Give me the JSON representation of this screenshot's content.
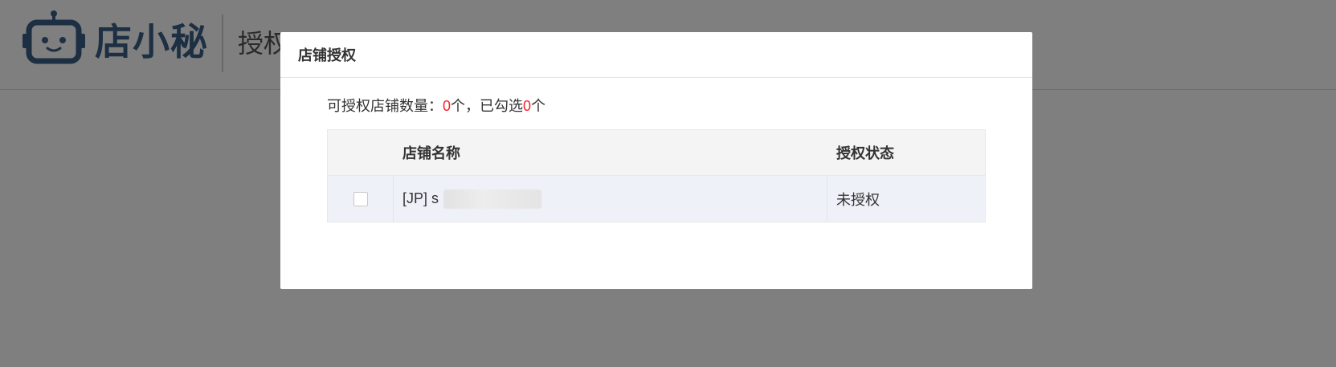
{
  "header": {
    "brand": "店小秘",
    "subtitle": "授权"
  },
  "modal": {
    "title": "店铺授权",
    "summary": {
      "prefix": "可授权店铺数量：",
      "available_count": "0",
      "middle": "个，已勾选",
      "selected_count": "0",
      "suffix": "个"
    },
    "table": {
      "columns": [
        "店铺名称",
        "授权状态"
      ],
      "rows": [
        {
          "shop_name": "[JP] s",
          "status": "未授权",
          "checked": false
        }
      ]
    }
  },
  "colors": {
    "brand": "#3a5f86",
    "highlight": "#f5222d",
    "overlay": "rgba(0,0,0,0.5)"
  },
  "icons": {
    "logo": "robot-logo-icon"
  }
}
